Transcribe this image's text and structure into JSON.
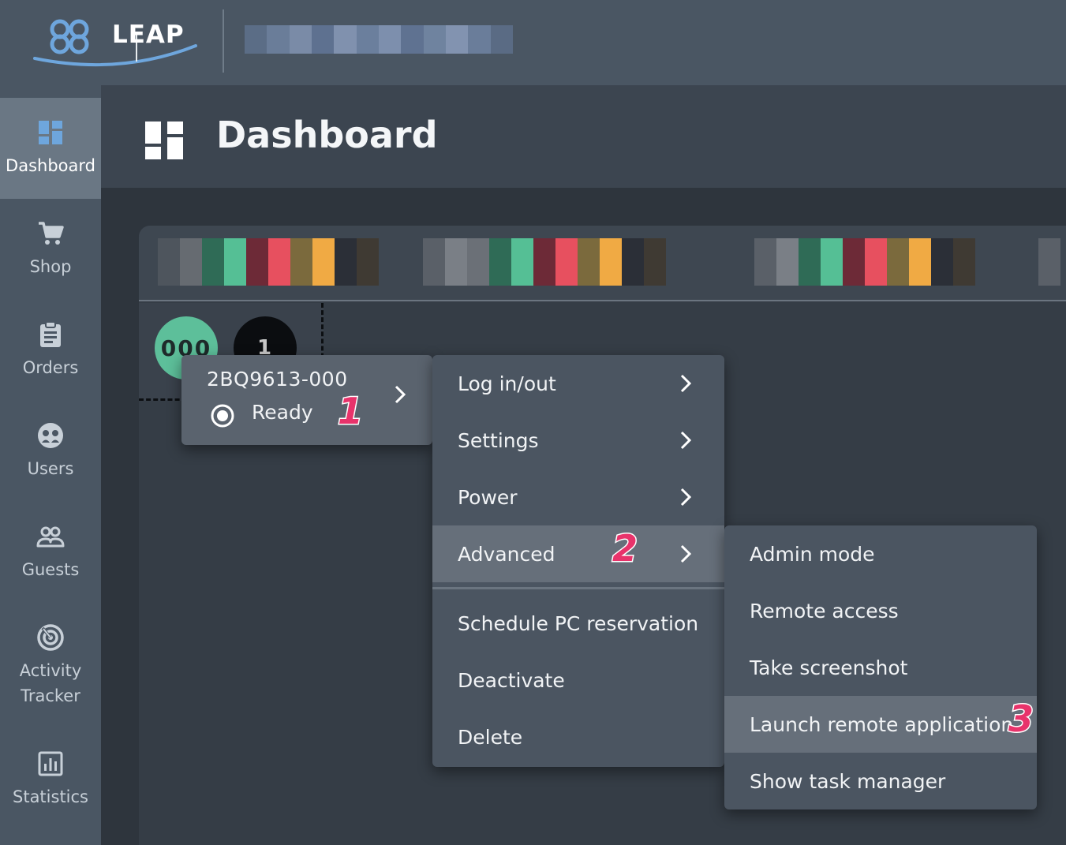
{
  "header": {
    "brand": "LEAP"
  },
  "sidebar": {
    "items": [
      {
        "label": "Dashboard",
        "icon": "dashboard-icon",
        "active": true
      },
      {
        "label": "Shop",
        "icon": "cart-icon",
        "active": false
      },
      {
        "label": "Orders",
        "icon": "clipboard-icon",
        "active": false
      },
      {
        "label": "Users",
        "icon": "users-icon",
        "active": false
      },
      {
        "label": "Guests",
        "icon": "guests-icon",
        "active": false
      },
      {
        "label": "Activity Tracker",
        "icon": "activity-icon",
        "active": false
      },
      {
        "label": "Statistics",
        "icon": "statistics-icon",
        "active": false
      }
    ]
  },
  "page": {
    "title": "Dashboard"
  },
  "pc_tiles": [
    {
      "label": "000",
      "color": "#5dbf9a"
    },
    {
      "label": "1",
      "color": "#0b0d10"
    }
  ],
  "pc_card": {
    "id": "2BQ9613-000",
    "status": "Ready",
    "step_badge": "1"
  },
  "context_menu": {
    "items": [
      {
        "label": "Log in/out",
        "has_submenu": true
      },
      {
        "label": "Settings",
        "has_submenu": true
      },
      {
        "label": "Power",
        "has_submenu": true
      },
      {
        "label": "Advanced",
        "has_submenu": true,
        "highlighted": true
      },
      {
        "label": "Schedule PC reservation",
        "has_submenu": false
      },
      {
        "label": "Deactivate",
        "has_submenu": false
      },
      {
        "label": "Delete",
        "has_submenu": false
      }
    ],
    "step_badge": "2"
  },
  "advanced_submenu": {
    "items": [
      {
        "label": "Admin mode"
      },
      {
        "label": "Remote access"
      },
      {
        "label": "Take screenshot"
      },
      {
        "label": "Launch remote application",
        "highlighted": true
      },
      {
        "label": "Show task manager"
      }
    ],
    "step_badge": "3"
  },
  "colors": {
    "accent_badge": "#e8336b",
    "sidebar_bg": "#4a5663",
    "menu_bg": "#4b5561",
    "menu_highlight": "#666f7a"
  }
}
